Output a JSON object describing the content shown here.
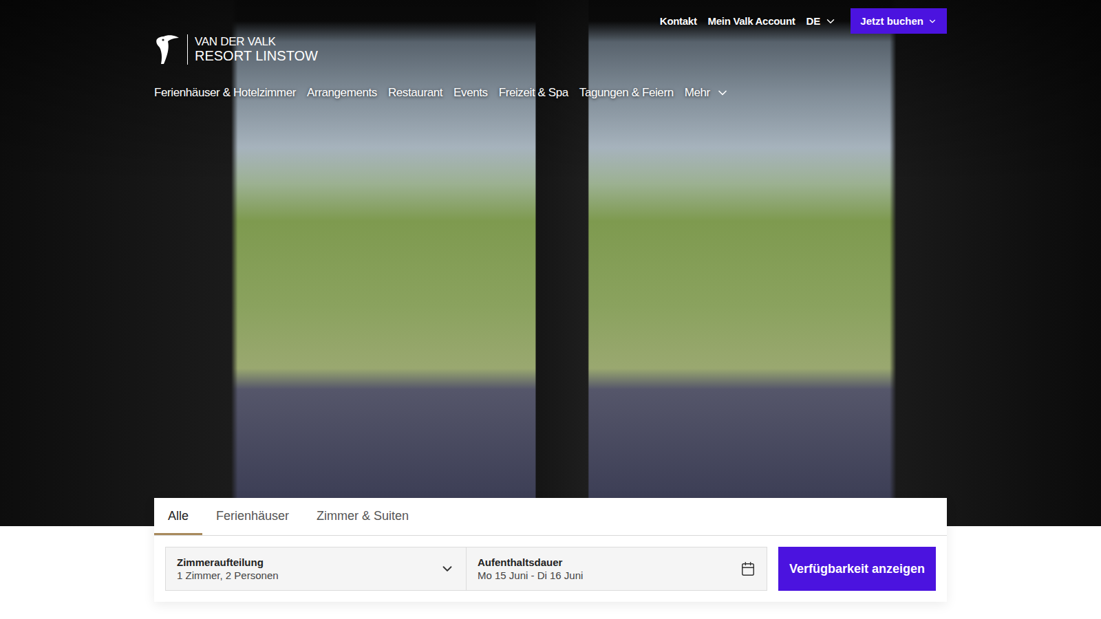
{
  "header": {
    "links": [
      "Kontakt",
      "Mein Valk Account"
    ],
    "language": "DE",
    "book_button": "Jetzt buchen"
  },
  "logo": {
    "line1": "VAN DER VALK",
    "line2": "RESORT LINSTOW"
  },
  "nav": {
    "items": [
      "Ferienhäuser & Hotelzimmer",
      "Arrangements",
      "Restaurant",
      "Events",
      "Freizeit & Spa",
      "Tagungen & Feiern"
    ],
    "more": "Mehr"
  },
  "booking": {
    "tabs": [
      {
        "label": "Alle",
        "selected": true
      },
      {
        "label": "Ferienhäuser",
        "selected": false
      },
      {
        "label": "Zimmer & Suiten",
        "selected": false
      }
    ],
    "fields": [
      {
        "label": "Zimmeraufteilung",
        "value": "1 Zimmer, 2 Personen",
        "kind": "dropdown"
      },
      {
        "label": "Aufenthaltsdauer",
        "value": "Mo 15 Juni - Di 16 Juni",
        "kind": "date"
      }
    ],
    "submit": "Verfügbarkeit anzeigen"
  }
}
